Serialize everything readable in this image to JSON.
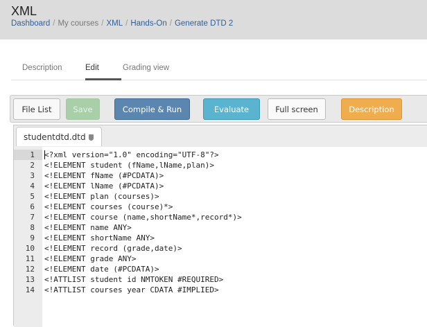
{
  "header": {
    "title": "XML",
    "breadcrumb": [
      "Dashboard",
      "My courses",
      "XML",
      "Hands-On",
      "Generate DTD 2"
    ]
  },
  "tabs": [
    {
      "label": "Description"
    },
    {
      "label": "Edit",
      "active": true
    },
    {
      "label": "Grading view"
    }
  ],
  "toolbar": {
    "file_list": "File List",
    "save": "Save",
    "compile_run": "Compile & Run",
    "evaluate": "Evaluate",
    "full_screen": "Full screen",
    "description": "Description"
  },
  "colors": {
    "compile": "#5b86b0",
    "evaluate": "#5ab4cf",
    "description": "#f0ad4e",
    "save": "#a8cfa8"
  },
  "editor": {
    "file_tab": "studentdtd.dtd",
    "lock_icon": "shield-icon",
    "lines": [
      "<?xml version=\"1.0\" encoding=\"UTF-8\"?>",
      "<!ELEMENT student (fName,lName,plan)>",
      "<!ELEMENT fName (#PCDATA)>",
      "<!ELEMENT lName (#PCDATA)>",
      "<!ELEMENT plan (courses)>",
      "<!ELEMENT courses (course)*>",
      "<!ELEMENT course (name,shortName*,record*)>",
      "<!ELEMENT name ANY>",
      "<!ELEMENT shortName ANY>",
      "<!ELEMENT record (grade,date)>",
      "<!ELEMENT grade ANY>",
      "<!ELEMENT date (#PCDATA)>",
      "<!ATTLIST student id NMTOKEN #REQUIRED>",
      "<!ATTLIST courses year CDATA #IMPLIED>"
    ]
  }
}
